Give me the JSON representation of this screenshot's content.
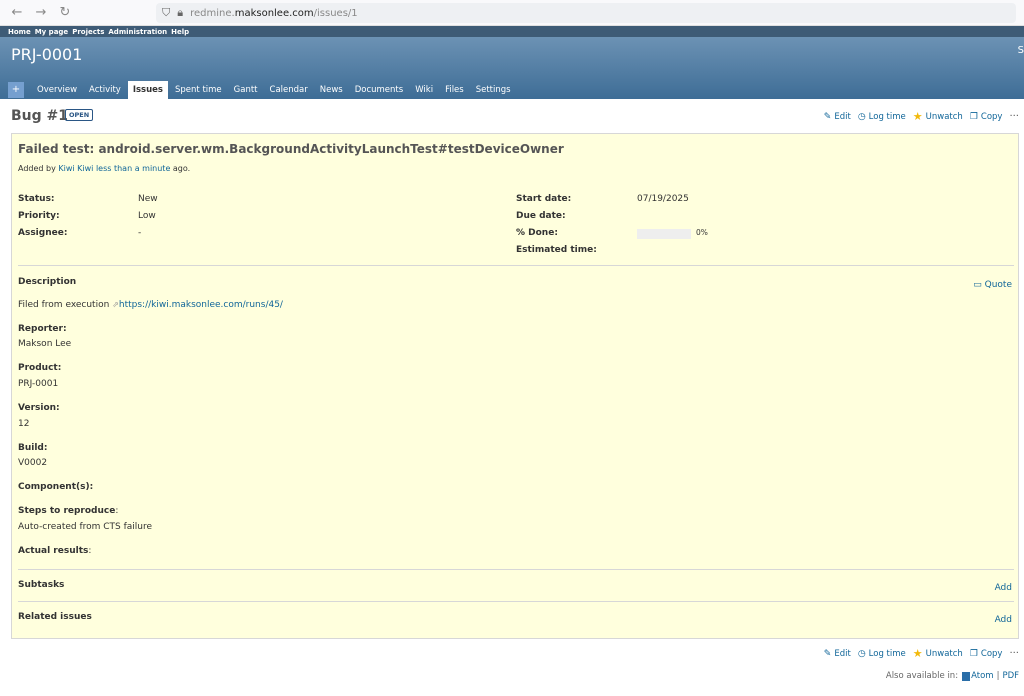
{
  "browser": {
    "url_prefix": "redmine.",
    "url_domain": "maksonlee.com",
    "url_path": "/issues/1"
  },
  "top_menu": [
    "Home",
    "My page",
    "Projects",
    "Administration",
    "Help"
  ],
  "header": {
    "project_title": "PRJ-0001",
    "right_text": "S"
  },
  "main_menu": {
    "plus": "+",
    "tabs": [
      "Overview",
      "Activity",
      "Issues",
      "Spent time",
      "Gantt",
      "Calendar",
      "News",
      "Documents",
      "Wiki",
      "Files",
      "Settings"
    ],
    "active": "Issues"
  },
  "issue": {
    "title": "Bug #1",
    "status_badge": "OPEN",
    "actions": {
      "edit": "Edit",
      "log_time": "Log time",
      "unwatch": "Unwatch",
      "copy": "Copy",
      "more": "···"
    },
    "subject": "Failed test: android.server.wm.BackgroundActivityLaunchTest#testDeviceOwner",
    "author_prefix": "Added by",
    "author": "Kiwi Kiwi",
    "author_time": "less than a minute",
    "author_suffix": "ago.",
    "attributes_left": [
      {
        "label": "Status:",
        "value": "New"
      },
      {
        "label": "Priority:",
        "value": "Low"
      },
      {
        "label": "Assignee:",
        "value": "-"
      }
    ],
    "attributes_right": [
      {
        "label": "Start date:",
        "value": "07/19/2025"
      },
      {
        "label": "Due date:",
        "value": ""
      },
      {
        "label": "% Done:",
        "value": "0%"
      },
      {
        "label": "Estimated time:",
        "value": ""
      }
    ],
    "done_ratio": 0,
    "description_title": "Description",
    "quote": "Quote",
    "description_prefix": "Filed from execution",
    "description_link": "https://kiwi.maksonlee.com/runs/45/",
    "custom_fields": [
      {
        "label": "Reporter:",
        "value": "Makson Lee"
      },
      {
        "label": "Product:",
        "value": "PRJ-0001"
      },
      {
        "label": "Version:",
        "value": "12"
      },
      {
        "label": "Build:",
        "value": "V0002"
      },
      {
        "label": "Component(s):",
        "value": ""
      },
      {
        "label": "Steps to reproduce",
        "suffix": ":",
        "value": "Auto-created from CTS failure"
      },
      {
        "label": "Actual results",
        "suffix": ":",
        "value": ""
      }
    ],
    "subtasks": "Subtasks",
    "related": "Related issues",
    "add": "Add"
  },
  "footer": {
    "also": "Also available in:",
    "atom": "Atom",
    "sep": "|",
    "pdf": "PDF"
  }
}
